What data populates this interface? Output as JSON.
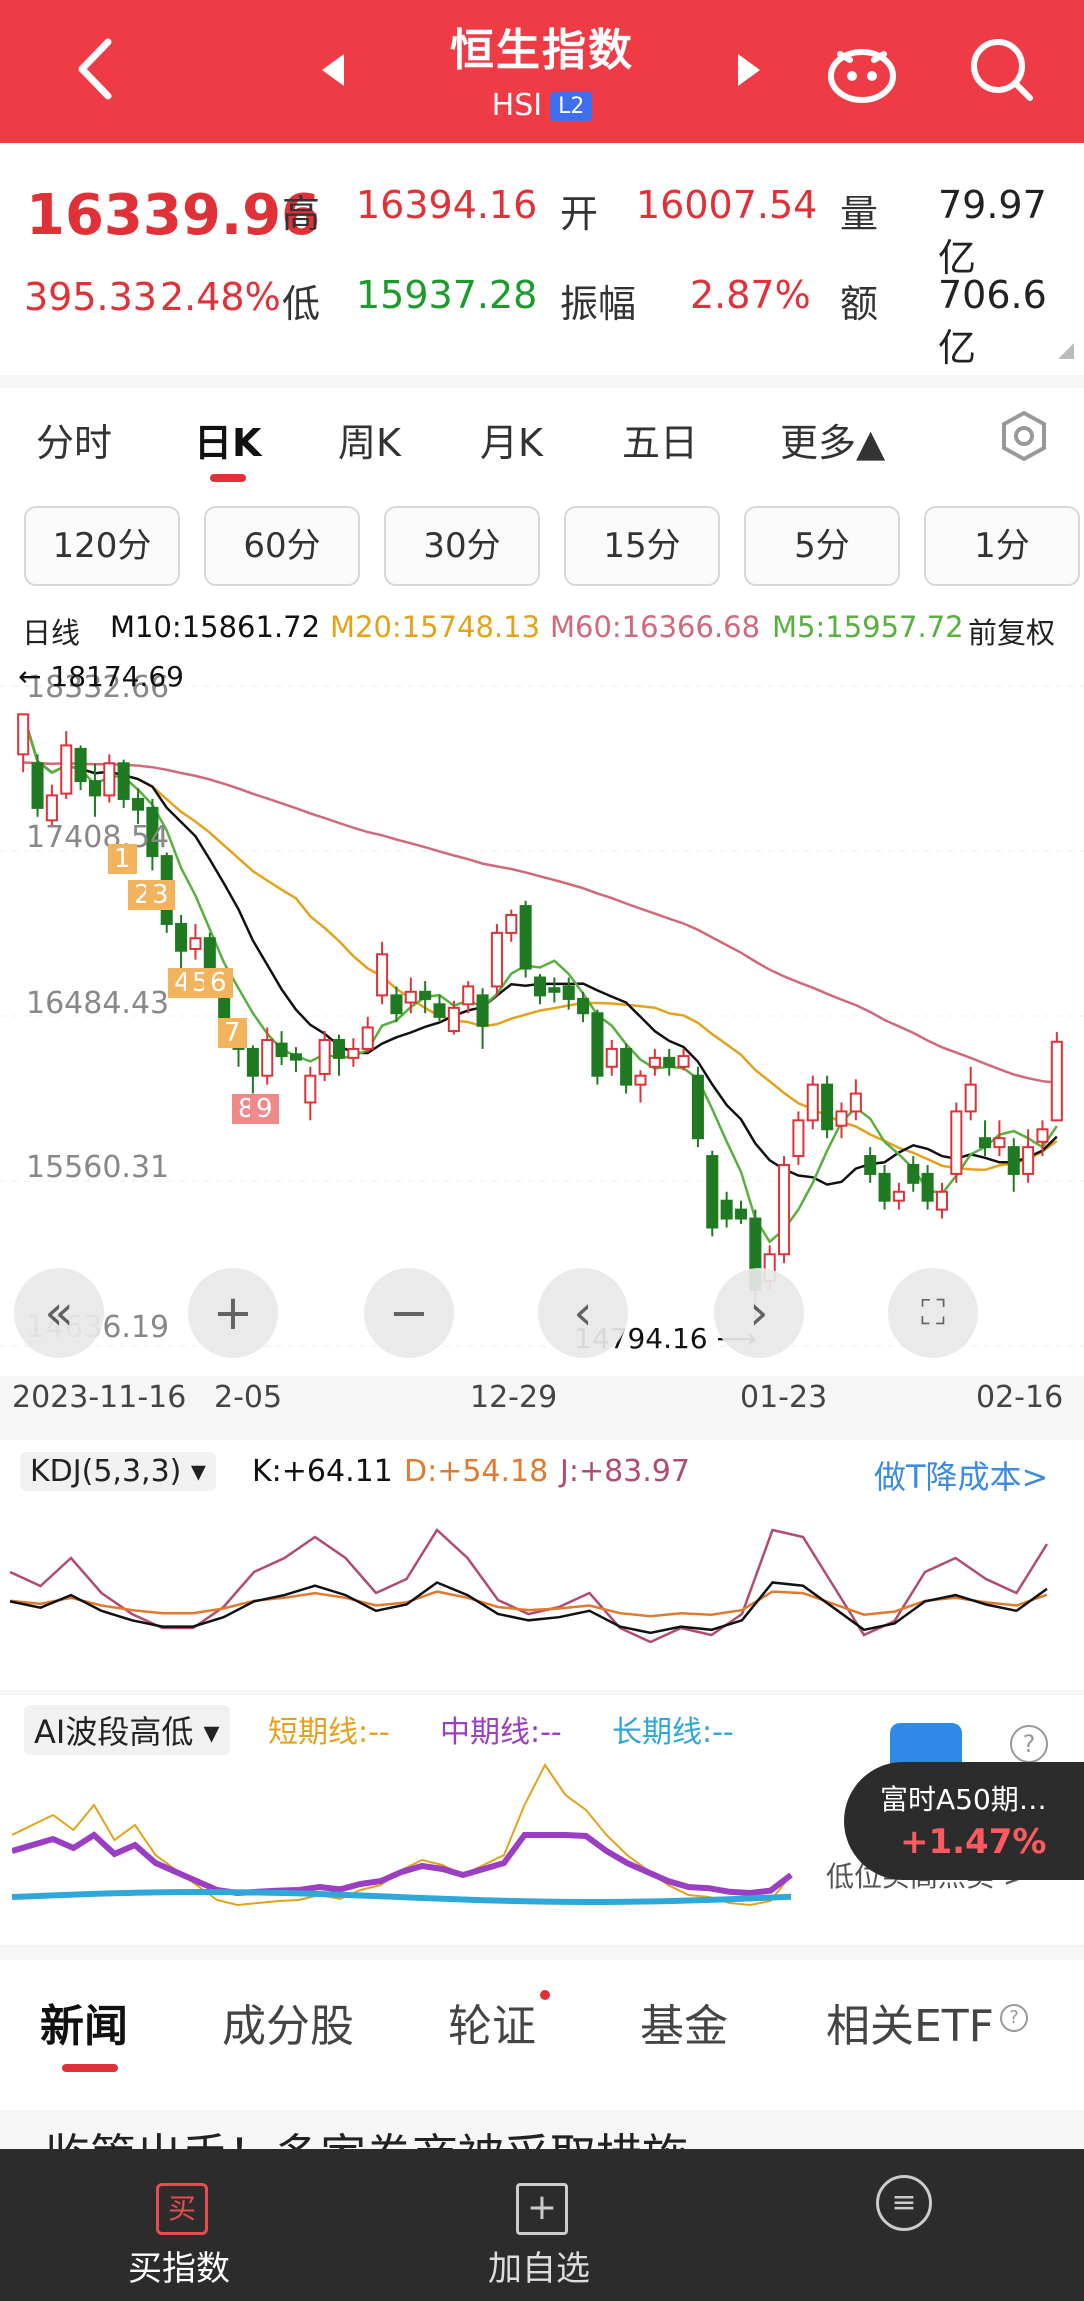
{
  "header": {
    "title": "恒生指数",
    "code": "HSI",
    "badge": "L2"
  },
  "quote": {
    "price": "16339.96",
    "change": "395.33",
    "change_pct": "2.48%",
    "high_label": "高",
    "high": "16394.16",
    "open_label": "开",
    "open": "16007.54",
    "volume_label": "量",
    "volume": "79.97亿",
    "low_label": "低",
    "low": "15937.28",
    "amp_label": "振幅",
    "amp": "2.87%",
    "amount_label": "额",
    "amount": "706.6亿"
  },
  "period_tabs": [
    {
      "label": "分时"
    },
    {
      "label": "日K"
    },
    {
      "label": "周K"
    },
    {
      "label": "月K"
    },
    {
      "label": "五日"
    },
    {
      "label": "更多▲"
    }
  ],
  "minute_pills": [
    "120分",
    "60分",
    "30分",
    "15分",
    "5分",
    "1分"
  ],
  "legend": {
    "kind": "日线",
    "m10": "M10:15861.72",
    "m20": "M20:15748.13",
    "m60": "M60:16366.68",
    "m5": "M5:15957.72",
    "adj": "前复权"
  },
  "kline": {
    "y_ticks": [
      "18332.66",
      "17408.54",
      "16484.43",
      "15560.31",
      "14636.19"
    ],
    "high_note": "18174.69",
    "low_note": "14794.16",
    "dates": [
      "2023-11-16",
      "2-05",
      "12-29",
      "01-23",
      "02-16"
    ],
    "nine_marks": [
      "1",
      "2",
      "3",
      "4",
      "5",
      "6",
      "7",
      "8",
      "9"
    ],
    "colors": {
      "up": "#e03138",
      "down": "#1f7a22",
      "m5": "#58b03e",
      "m10": "#111111",
      "m20": "#e3a21a",
      "m60": "#d0697a"
    }
  },
  "chart_data": {
    "type": "candlestick",
    "ylim": [
      14636.19,
      18332.66
    ],
    "candles": [
      {
        "o": 17950,
        "c": 18174,
        "h": 18174,
        "l": 17850
      },
      {
        "o": 17900,
        "c": 17650,
        "h": 17950,
        "l": 17600
      },
      {
        "o": 17580,
        "c": 17720,
        "h": 17780,
        "l": 17550
      },
      {
        "o": 17730,
        "c": 18000,
        "h": 18080,
        "l": 17700
      },
      {
        "o": 17980,
        "c": 17800,
        "h": 18000,
        "l": 17750
      },
      {
        "o": 17800,
        "c": 17720,
        "h": 17900,
        "l": 17600
      },
      {
        "o": 17720,
        "c": 17900,
        "h": 17950,
        "l": 17680
      },
      {
        "o": 17900,
        "c": 17700,
        "h": 17920,
        "l": 17650
      },
      {
        "o": 17700,
        "c": 17640,
        "h": 17760,
        "l": 17560
      },
      {
        "o": 17650,
        "c": 17380,
        "h": 17700,
        "l": 17300
      },
      {
        "o": 17380,
        "c": 17000,
        "h": 17400,
        "l": 16950
      },
      {
        "o": 17000,
        "c": 16850,
        "h": 17050,
        "l": 16750
      },
      {
        "o": 16860,
        "c": 16920,
        "h": 17000,
        "l": 16800
      },
      {
        "o": 16920,
        "c": 16700,
        "h": 16950,
        "l": 16650
      },
      {
        "o": 16700,
        "c": 16430,
        "h": 16730,
        "l": 16380
      },
      {
        "o": 16430,
        "c": 16300,
        "h": 16450,
        "l": 16200
      },
      {
        "o": 16300,
        "c": 16150,
        "h": 16320,
        "l": 16050
      },
      {
        "o": 16150,
        "c": 16350,
        "h": 16420,
        "l": 16100
      },
      {
        "o": 16330,
        "c": 16260,
        "h": 16400,
        "l": 16210
      },
      {
        "o": 16270,
        "c": 16240,
        "h": 16310,
        "l": 16170
      },
      {
        "o": 16000,
        "c": 16150,
        "h": 16200,
        "l": 15900
      },
      {
        "o": 16160,
        "c": 16350,
        "h": 16400,
        "l": 16120
      },
      {
        "o": 16350,
        "c": 16250,
        "h": 16380,
        "l": 16150
      },
      {
        "o": 16250,
        "c": 16300,
        "h": 16360,
        "l": 16200
      },
      {
        "o": 16300,
        "c": 16420,
        "h": 16480,
        "l": 16280
      },
      {
        "o": 16600,
        "c": 16830,
        "h": 16900,
        "l": 16550
      },
      {
        "o": 16600,
        "c": 16500,
        "h": 16650,
        "l": 16450
      },
      {
        "o": 16560,
        "c": 16620,
        "h": 16700,
        "l": 16500
      },
      {
        "o": 16620,
        "c": 16580,
        "h": 16680,
        "l": 16500
      },
      {
        "o": 16550,
        "c": 16480,
        "h": 16600,
        "l": 16450
      },
      {
        "o": 16400,
        "c": 16530,
        "h": 16570,
        "l": 16380
      },
      {
        "o": 16550,
        "c": 16650,
        "h": 16680,
        "l": 16500
      },
      {
        "o": 16600,
        "c": 16430,
        "h": 16640,
        "l": 16300
      },
      {
        "o": 16650,
        "c": 16950,
        "h": 17000,
        "l": 16600
      },
      {
        "o": 16950,
        "c": 17050,
        "h": 17080,
        "l": 16900
      },
      {
        "o": 17100,
        "c": 16750,
        "h": 17130,
        "l": 16700
      },
      {
        "o": 16700,
        "c": 16600,
        "h": 16720,
        "l": 16550
      },
      {
        "o": 16640,
        "c": 16620,
        "h": 16700,
        "l": 16560
      },
      {
        "o": 16650,
        "c": 16580,
        "h": 16700,
        "l": 16520
      },
      {
        "o": 16580,
        "c": 16500,
        "h": 16620,
        "l": 16450
      },
      {
        "o": 16500,
        "c": 16150,
        "h": 16520,
        "l": 16100
      },
      {
        "o": 16200,
        "c": 16300,
        "h": 16350,
        "l": 16150
      },
      {
        "o": 16300,
        "c": 16100,
        "h": 16330,
        "l": 16050
      },
      {
        "o": 16100,
        "c": 16150,
        "h": 16180,
        "l": 16000
      },
      {
        "o": 16200,
        "c": 16250,
        "h": 16300,
        "l": 16150
      },
      {
        "o": 16250,
        "c": 16200,
        "h": 16300,
        "l": 16150
      },
      {
        "o": 16200,
        "c": 16260,
        "h": 16300,
        "l": 16180
      },
      {
        "o": 16150,
        "c": 15800,
        "h": 16200,
        "l": 15750
      },
      {
        "o": 15700,
        "c": 15300,
        "h": 15730,
        "l": 15250
      },
      {
        "o": 15450,
        "c": 15350,
        "h": 15500,
        "l": 15300
      },
      {
        "o": 15400,
        "c": 15350,
        "h": 15450,
        "l": 15320
      },
      {
        "o": 15350,
        "c": 14950,
        "h": 15400,
        "l": 14794
      },
      {
        "o": 15000,
        "c": 15150,
        "h": 15200,
        "l": 14950
      },
      {
        "o": 15150,
        "c": 15650,
        "h": 15700,
        "l": 15100
      },
      {
        "o": 15700,
        "c": 15900,
        "h": 15950,
        "l": 15650
      },
      {
        "o": 15900,
        "c": 16100,
        "h": 16150,
        "l": 15850
      },
      {
        "o": 16100,
        "c": 15850,
        "h": 16150,
        "l": 15800
      },
      {
        "o": 15870,
        "c": 15950,
        "h": 16000,
        "l": 15800
      },
      {
        "o": 15950,
        "c": 16050,
        "h": 16130,
        "l": 15900
      },
      {
        "o": 15700,
        "c": 15600,
        "h": 15750,
        "l": 15550
      },
      {
        "o": 15600,
        "c": 15450,
        "h": 15650,
        "l": 15400
      },
      {
        "o": 15450,
        "c": 15500,
        "h": 15550,
        "l": 15400
      },
      {
        "o": 15650,
        "c": 15550,
        "h": 15700,
        "l": 15500
      },
      {
        "o": 15600,
        "c": 15450,
        "h": 15650,
        "l": 15400
      },
      {
        "o": 15400,
        "c": 15500,
        "h": 15550,
        "l": 15350
      },
      {
        "o": 15600,
        "c": 15950,
        "h": 16000,
        "l": 15550
      },
      {
        "o": 15950,
        "c": 16100,
        "h": 16200,
        "l": 15900
      },
      {
        "o": 15800,
        "c": 15750,
        "h": 15900,
        "l": 15700
      },
      {
        "o": 15750,
        "c": 15800,
        "h": 15900,
        "l": 15700
      },
      {
        "o": 15750,
        "c": 15600,
        "h": 15800,
        "l": 15500
      },
      {
        "o": 15600,
        "c": 15750,
        "h": 15850,
        "l": 15550
      },
      {
        "o": 15780,
        "c": 15850,
        "h": 15900,
        "l": 15700
      },
      {
        "o": 15900,
        "c": 16340,
        "h": 16394,
        "l": 15937
      }
    ]
  },
  "kdj": {
    "name": "KDJ(5,3,3)",
    "k": "K:+64.11",
    "d": "D:+54.18",
    "j": "J:+83.97",
    "promo": "做T降成本>"
  },
  "ai": {
    "name": "AI波段高低",
    "short": "短期线:--",
    "mid": "中期线:--",
    "long": "长期线:--",
    "badge_title": "富时A50期…",
    "badge_value": "+1.47%",
    "hint": "低位买高点卖 >"
  },
  "news_tabs": [
    "新闻",
    "成分股",
    "轮证",
    "基金",
    "相关ETF"
  ],
  "news_headline": "监管出手！多家券商被采取措施",
  "bottom": {
    "buy": "买指数",
    "add": "加自选"
  }
}
